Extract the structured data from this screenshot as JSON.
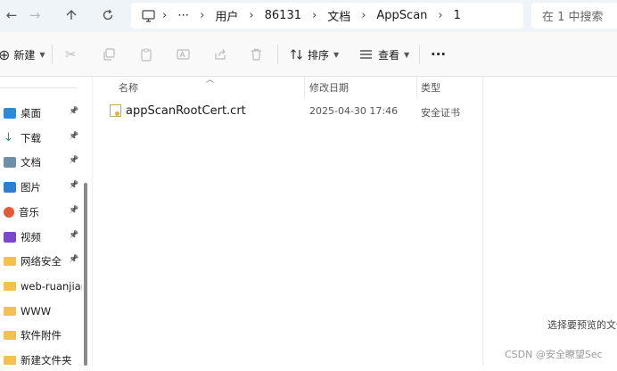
{
  "address_bar": {
    "back_icon": "arrow-left-icon",
    "forward_icon": "arrow-right-icon",
    "up_icon": "arrow-up-icon",
    "refresh_icon": "refresh-icon",
    "computer_icon": "computer-icon",
    "ellipsis": "⋯",
    "breadcrumbs": [
      "用户",
      "86131",
      "文档",
      "AppScan",
      "1"
    ]
  },
  "search": {
    "placeholder": "在 1 中搜索"
  },
  "toolbar": {
    "new_label": "新建",
    "sort_label": "排序",
    "view_label": "查看",
    "more_label": "···"
  },
  "sidebar": {
    "items": [
      {
        "label": "桌面",
        "icon": "desktop-icon",
        "color": "#2a8dd4",
        "pinned": true
      },
      {
        "label": "下载",
        "icon": "download-icon",
        "color": "#1a9c6c",
        "pinned": true
      },
      {
        "label": "文档",
        "icon": "document-icon",
        "color": "#6f8ea8",
        "pinned": true
      },
      {
        "label": "图片",
        "icon": "pictures-icon",
        "color": "#2f7fd0",
        "pinned": true
      },
      {
        "label": "音乐",
        "icon": "music-icon",
        "color": "#e35a36",
        "pinned": true
      },
      {
        "label": "视频",
        "icon": "video-icon",
        "color": "#7b48c9",
        "pinned": true
      },
      {
        "label": "网络安全",
        "icon": "folder-icon",
        "color": "#f1c24d",
        "pinned": true
      },
      {
        "label": "web-ruanjianf",
        "icon": "folder-icon",
        "color": "#f1c24d",
        "pinned": false
      },
      {
        "label": "WWW",
        "icon": "folder-icon",
        "color": "#f1c24d",
        "pinned": false
      },
      {
        "label": "软件附件",
        "icon": "folder-icon",
        "color": "#f1c24d",
        "pinned": false
      },
      {
        "label": "新建文件夹",
        "icon": "folder-icon",
        "color": "#f1c24d",
        "pinned": false
      }
    ]
  },
  "file_list": {
    "columns": {
      "name": "名称",
      "modified": "修改日期",
      "type": "类型"
    },
    "rows": [
      {
        "name": "appScanRootCert.crt",
        "modified": "2025-04-30 17:46",
        "type": "安全证书",
        "icon": "certificate-file-icon"
      }
    ]
  },
  "preview_pane": {
    "message": "选择要预览的文件"
  },
  "watermark": "CSDN @安全瞭望Sec"
}
